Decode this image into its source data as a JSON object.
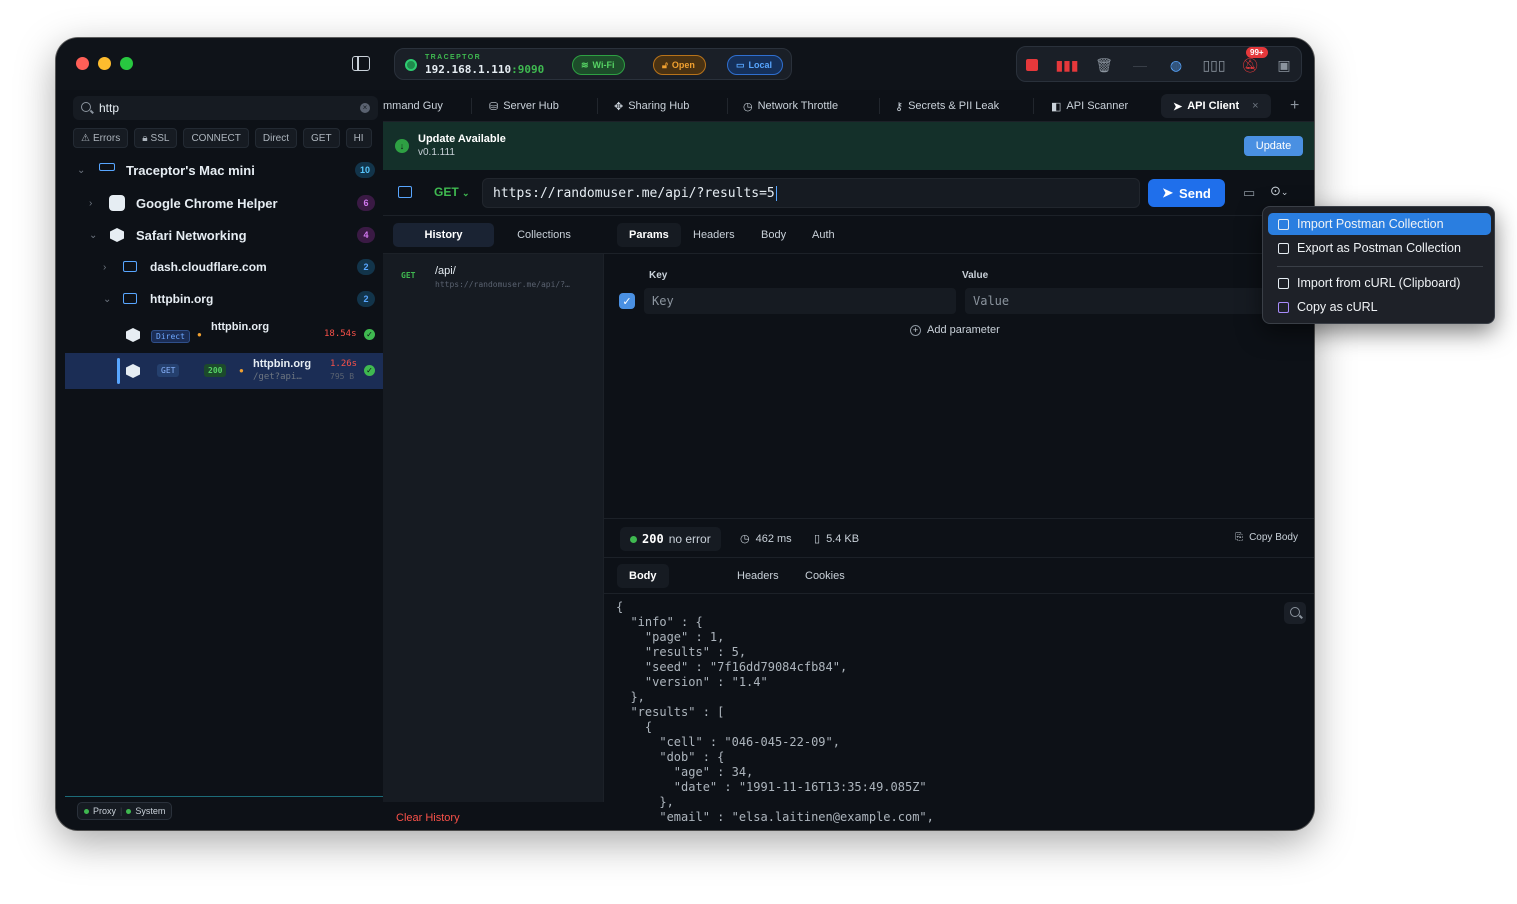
{
  "titlebar": {
    "traceptor_label": "TRACEPTOR",
    "ip": "192.168.1.110",
    "port": ":9090",
    "wifi": "Wi-Fi",
    "open": "Open",
    "local": "Local",
    "notif_badge": "99+"
  },
  "sidebar": {
    "search_value": "http",
    "filters": [
      "Errors",
      "SSL",
      "CONNECT",
      "Direct",
      "GET",
      "HI"
    ],
    "root": {
      "label": "Traceptor's Mac mini",
      "count": "10"
    },
    "apps": [
      {
        "label": "Google Chrome Helper",
        "count": "6"
      },
      {
        "label": "Safari Networking",
        "count": "4"
      }
    ],
    "hosts": [
      {
        "label": "dash.cloudflare.com",
        "count": "2"
      },
      {
        "label": "httpbin.org",
        "count": "2"
      }
    ],
    "requests": [
      {
        "tag": "Direct",
        "host": "httpbin.org",
        "time": "18.54s"
      },
      {
        "method": "GET",
        "status": "200",
        "host": "httpbin.org",
        "path": "/get?api…",
        "time": "1.26s",
        "size": "795 B"
      }
    ],
    "footer": {
      "proxy": "Proxy",
      "system": "System"
    }
  },
  "tabs": [
    {
      "label": "mmand Guy"
    },
    {
      "label": "Server Hub"
    },
    {
      "label": "Sharing Hub"
    },
    {
      "label": "Network Throttle"
    },
    {
      "label": "Secrets & PII Leak"
    },
    {
      "label": "API Scanner"
    },
    {
      "label": "API Client"
    }
  ],
  "banner": {
    "title": "Update Available",
    "version": "v0.1.111",
    "button": "Update"
  },
  "request": {
    "method": "GET",
    "url": "https://randomuser.me/api/?results=5",
    "send": "Send"
  },
  "history": {
    "tabs": [
      "History",
      "Collections"
    ],
    "items": [
      {
        "method": "GET",
        "path": "/api/",
        "url": "https://randomuser.me/api/?…"
      }
    ],
    "clear": "Clear History"
  },
  "params": {
    "tabs": [
      "Params",
      "Headers",
      "Body",
      "Auth"
    ],
    "key_header": "Key",
    "value_header": "Value",
    "key_placeholder": "Key",
    "value_placeholder": "Value",
    "add": "Add parameter"
  },
  "response": {
    "status_code": "200",
    "status_text": "no error",
    "time": "462 ms",
    "size": "5.4 KB",
    "copy": "Copy Body",
    "tabs": [
      "Body",
      "Headers",
      "Cookies"
    ],
    "body_lines": [
      "{",
      "  \"info\" : {",
      "    \"page\" : 1,",
      "    \"results\" : 5,",
      "    \"seed\" : \"7f16dd79084cfb84\",",
      "    \"version\" : \"1.4\"",
      "  },",
      "  \"results\" : [",
      "    {",
      "      \"cell\" : \"046-045-22-09\",",
      "      \"dob\" : {",
      "        \"age\" : 34,",
      "        \"date\" : \"1991-11-16T13:35:49.085Z\"",
      "      },",
      "      \"email\" : \"elsa.laitinen@example.com\","
    ]
  },
  "menu": {
    "items": [
      "Import Postman Collection",
      "Export as Postman Collection",
      "Import from cURL (Clipboard)",
      "Copy as cURL"
    ]
  },
  "colors": {
    "accent": "#1f6feb",
    "success": "#3fb950",
    "danger": "#e5383b"
  }
}
